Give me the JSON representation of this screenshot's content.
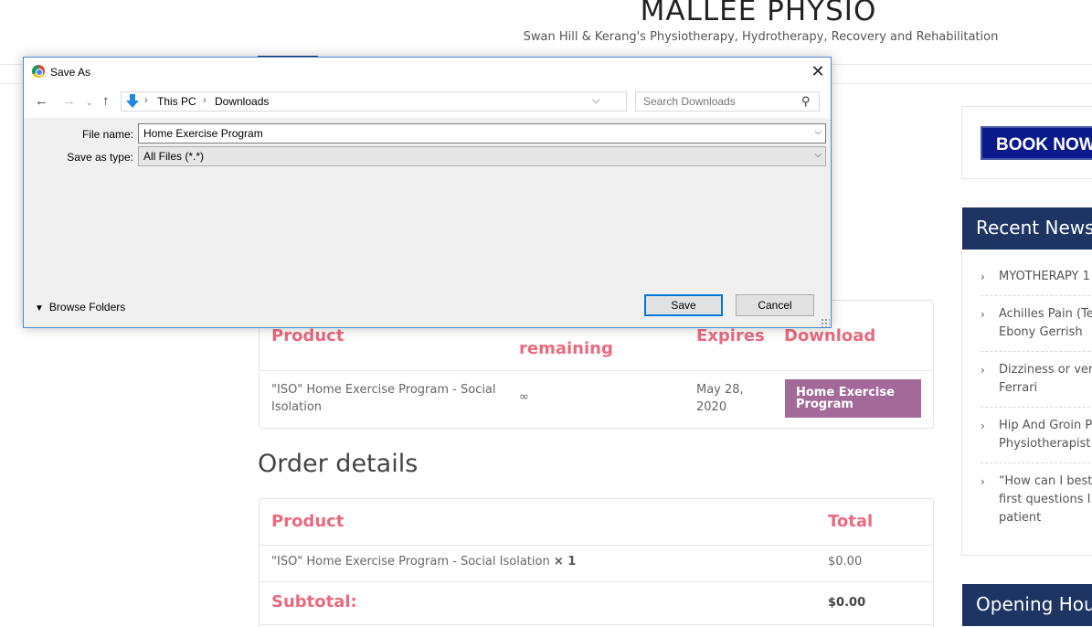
{
  "site": {
    "title": "MALLEE PHYSIO",
    "tagline": "Swan Hill & Kerang's Physiotherapy, Hydrotherapy, Recovery and Rehabilitation"
  },
  "downloads": {
    "headers": {
      "product": "Product",
      "remaining": "remaining",
      "expires": "Expires",
      "download": "Download"
    },
    "row": {
      "product": "\"ISO\" Home Exercise Program - Social Isolation",
      "remaining": "∞",
      "expires": "May 28, 2020",
      "download_label": "Home Exercise Program"
    }
  },
  "order": {
    "heading": "Order details",
    "headers": {
      "product": "Product",
      "total": "Total"
    },
    "item": {
      "name": "\"ISO\" Home Exercise Program - Social Isolation",
      "qty": "× 1",
      "total": "$0.00"
    },
    "subtotal": {
      "label": "Subtotal:",
      "value": "$0.00"
    }
  },
  "sidebar": {
    "book_label": "BOOK NOW",
    "recent_news_title": "Recent News",
    "news": [
      {
        "line1": "MYOTHERAPY 1",
        "line2": ""
      },
      {
        "line1": "Achilles Pain (Te",
        "line2": "Ebony Gerrish"
      },
      {
        "line1": "Dizziness or vert",
        "line2": "Ferrari"
      },
      {
        "line1": "Hip And Groin P",
        "line2": "Physiotherapist"
      },
      {
        "line1": "“How can I best",
        "line2": "first questions I",
        "line3": "patient"
      }
    ],
    "opening_hours_title": "Opening Hou"
  },
  "dialog": {
    "title": "Save As",
    "close_icon": "close-icon",
    "breadcrumb": [
      "This PC",
      "Downloads"
    ],
    "search_placeholder": "Search Downloads",
    "file_name_label": "File name:",
    "file_name_value": "Home Exercise Program",
    "save_type_label": "Save as type:",
    "save_type_value": "All Files (*.*)",
    "browse_label": "Browse Folders",
    "save_label": "Save",
    "cancel_label": "Cancel"
  },
  "colors": {
    "accent_pink": "#e96a7d",
    "download_button": "#a36a99",
    "navy": "#1e3563",
    "book_button": "#0a1a8c"
  }
}
